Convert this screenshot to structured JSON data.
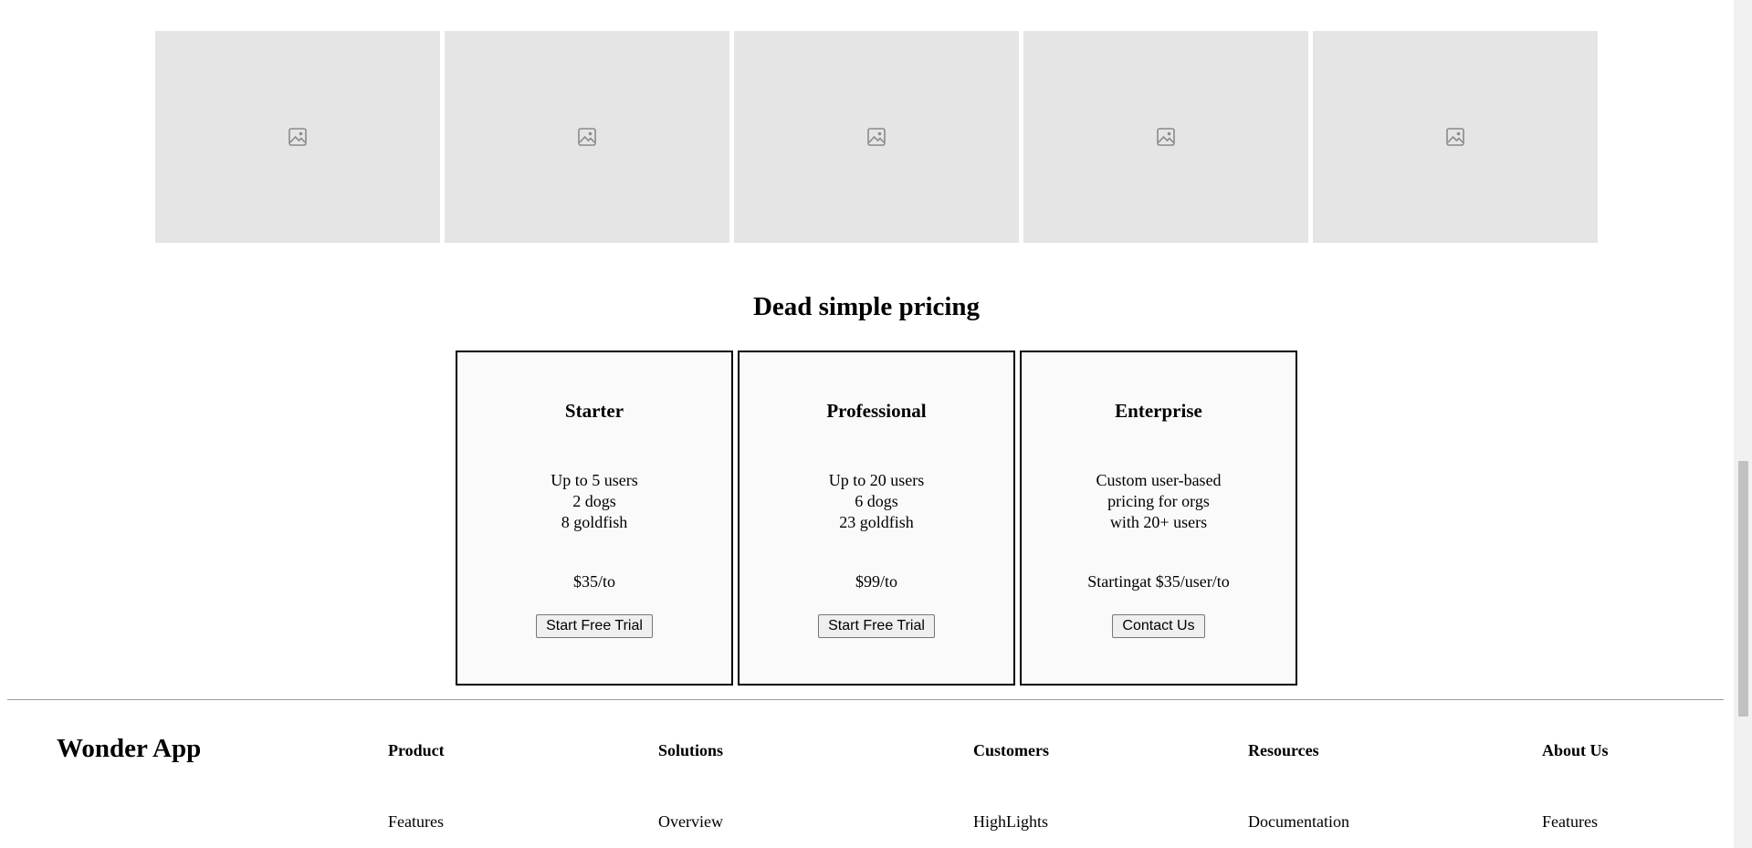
{
  "gallery": {
    "items": [
      {
        "icon": "image-placeholder-icon"
      },
      {
        "icon": "image-placeholder-icon"
      },
      {
        "icon": "image-placeholder-icon"
      },
      {
        "icon": "image-placeholder-icon"
      },
      {
        "icon": "image-placeholder-icon"
      }
    ]
  },
  "pricing": {
    "title": "Dead simple pricing",
    "plans": [
      {
        "name": "Starter",
        "lines": [
          "Up to 5 users",
          "2 dogs",
          "8 goldfish"
        ],
        "price": "$35/to",
        "button": "Start Free Trial"
      },
      {
        "name": "Professional",
        "lines": [
          "Up to 20 users",
          "6 dogs",
          "23 goldfish"
        ],
        "price": "$99/to",
        "button": "Start Free Trial"
      },
      {
        "name": "Enterprise",
        "lines": [
          "Custom user-based",
          "pricing for orgs",
          "with 20+ users"
        ],
        "price": "Startingat $35/user/to",
        "button": "Contact Us"
      }
    ]
  },
  "footer": {
    "brand": "Wonder App",
    "columns": [
      {
        "title": "Product",
        "first_link": "Features"
      },
      {
        "title": "Solutions",
        "first_link": "Overview"
      },
      {
        "title": "Customers",
        "first_link": "HighLights"
      },
      {
        "title": "Resources",
        "first_link": "Documentation"
      },
      {
        "title": "About Us",
        "first_link": "Features"
      }
    ]
  },
  "colors": {
    "placeholder_bg": "#e5e5e5",
    "card_bg": "#fafafa",
    "divider": "#9a9a9a"
  }
}
